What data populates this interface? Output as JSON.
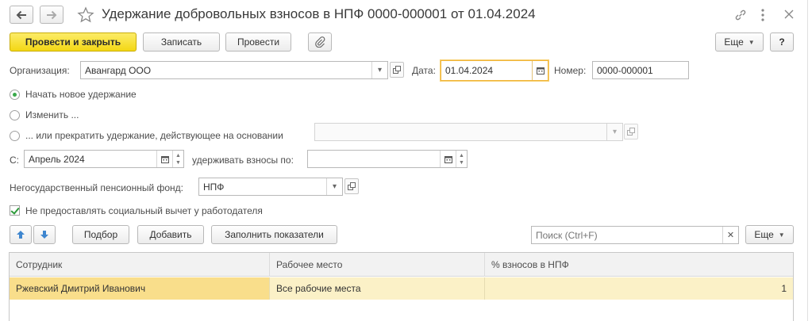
{
  "header": {
    "title": "Удержание добровольных взносов в НПФ 0000-000001 от 01.04.2024"
  },
  "toolbar": {
    "post_close": "Провести и закрыть",
    "save": "Записать",
    "post": "Провести",
    "more": "Еще",
    "help": "?"
  },
  "form": {
    "org_label": "Организация:",
    "org_value": "Авангард ООО",
    "date_label": "Дата:",
    "date_value": "01.04.2024",
    "number_label": "Номер:",
    "number_value": "0000-000001",
    "radio_new": "Начать новое удержание",
    "radio_change": "Изменить ...",
    "radio_stop": "... или прекратить удержание, действующее на основании",
    "from_label": "С:",
    "from_value": "Апрель 2024",
    "until_label": "удерживать взносы по:",
    "until_value": "",
    "fund_label": "Негосударственный пенсионный фонд:",
    "fund_value": "НПФ",
    "no_deduction_label": "Не предоставлять социальный вычет у работодателя"
  },
  "table_toolbar": {
    "pick": "Подбор",
    "add": "Добавить",
    "fill": "Заполнить показатели",
    "search_placeholder": "Поиск (Ctrl+F)",
    "more": "Еще"
  },
  "table": {
    "columns": [
      "Сотрудник",
      "Рабочее место",
      "% взносов в НПФ"
    ],
    "rows": [
      {
        "employee": "Ржевский Дмитрий Иванович",
        "workplace": "Все рабочие места",
        "percent": "1"
      }
    ]
  }
}
